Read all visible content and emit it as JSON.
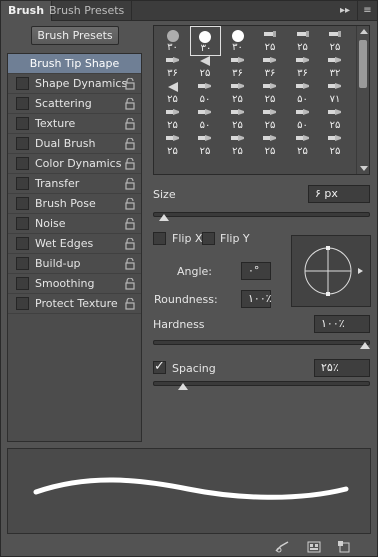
{
  "tabs": {
    "active": "Brush",
    "inactive": "Brush Presets",
    "collapse_glyph": "▸▸",
    "menu_glyph": "≡"
  },
  "left": {
    "presets_button": "Brush Presets",
    "tip_shape": "Brush Tip Shape",
    "options": [
      {
        "label": "Shape Dynamics"
      },
      {
        "label": "Scattering"
      },
      {
        "label": "Texture"
      },
      {
        "label": "Dual Brush"
      },
      {
        "label": "Color Dynamics"
      },
      {
        "label": "Transfer"
      },
      {
        "label": "Brush Pose"
      },
      {
        "label": "Noise"
      },
      {
        "label": "Wet Edges"
      },
      {
        "label": "Build-up"
      },
      {
        "label": "Smoothing"
      },
      {
        "label": "Protect Texture"
      }
    ]
  },
  "grid": {
    "rows": [
      [
        "۳۰",
        "۳۰",
        "۳۰",
        "۲۵",
        "۲۵",
        "۲۵"
      ],
      [
        "۳۶",
        "۲۵",
        "۳۶",
        "۳۶",
        "۳۶",
        "۳۲"
      ],
      [
        "۲۵",
        "۵۰",
        "۲۵",
        "۲۵",
        "۵۰",
        "۷۱"
      ],
      [
        "۲۵",
        "۵۰",
        "۲۵",
        "۲۵",
        "۵۰",
        "۲۵"
      ],
      [
        "۲۵",
        "۲۵",
        "۲۵",
        "۲۵",
        "۲۵",
        "۲۵"
      ]
    ]
  },
  "controls": {
    "size_label": "Size",
    "size_value": "۶ px",
    "size_slider_pct": 3,
    "flip_x": "Flip X",
    "flip_y": "Flip Y",
    "angle_label": "Angle:",
    "angle_value": "۰°",
    "roundness_label": "Roundness:",
    "roundness_value": "۱۰۰٪",
    "hardness_label": "Hardness",
    "hardness_value": "۱۰۰٪",
    "hardness_slider_pct": 100,
    "spacing_label": "Spacing",
    "spacing_checked": true,
    "spacing_value": "۲۵٪",
    "spacing_slider_pct": 12
  },
  "colors": {
    "selection": "#6f7f95",
    "panel": "#535353",
    "field": "#3e3e3e"
  }
}
